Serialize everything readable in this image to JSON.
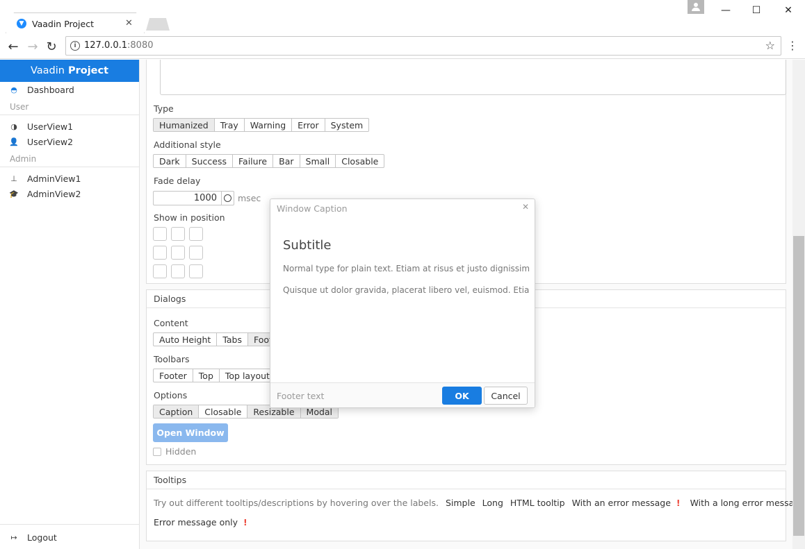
{
  "browser": {
    "tab_title": "Vaadin Project",
    "url_host": "127.0.0.1",
    "url_port": ":8080"
  },
  "sidebar": {
    "title_plain": "Vaadin",
    "title_bold": "Project",
    "dashboard": "Dashboard",
    "section_user": "User",
    "userview1": "UserView1",
    "userview2": "UserView2",
    "section_admin": "Admin",
    "adminview1": "AdminView1",
    "adminview2": "AdminView2",
    "logout": "Logout"
  },
  "notifications": {
    "type_label": "Type",
    "types": [
      "Humanized",
      "Tray",
      "Warning",
      "Error",
      "System"
    ],
    "style_label": "Additional style",
    "styles": [
      "Dark",
      "Success",
      "Failure",
      "Bar",
      "Small",
      "Closable"
    ],
    "fade_label": "Fade delay",
    "fade_value": "1000",
    "fade_unit": "msec",
    "position_label": "Show in position"
  },
  "dialogs": {
    "caption": "Dialogs",
    "content_label": "Content",
    "content": [
      "Auto Height",
      "Tabs",
      "Footer"
    ],
    "toolbars_label": "Toolbars",
    "toolbars": [
      "Footer",
      "Top",
      "Top layout"
    ],
    "options_label": "Options",
    "options": [
      "Caption",
      "Closable",
      "Resizable",
      "Modal"
    ],
    "open_window": "Open Window",
    "hidden": "Hidden"
  },
  "tooltips": {
    "caption": "Tooltips",
    "intro": "Try out different tooltips/descriptions by hovering over the labels.",
    "simple": "Simple",
    "long": "Long",
    "html": "HTML tooltip",
    "with_error": "With an error message",
    "long_error": "With a long error message",
    "error_only": "Error message only"
  },
  "window": {
    "caption": "Window Caption",
    "subtitle": "Subtitle",
    "p1": "Normal type for plain text. Etiam at risus et justo dignissim congue",
    "p2": "Quisque ut dolor gravida, placerat libero vel, euismod. Etiam habe",
    "footer_text": "Footer text",
    "ok": "OK",
    "cancel": "Cancel"
  },
  "colors": {
    "accent": "#197de1",
    "error": "#ed473b"
  }
}
